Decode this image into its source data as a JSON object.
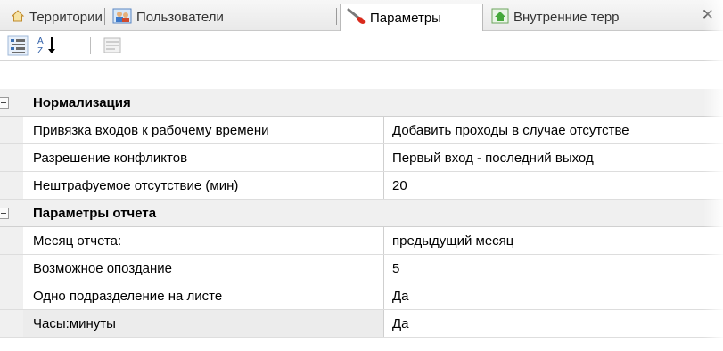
{
  "tabs": [
    {
      "label": "Территории",
      "icon": "home-icon"
    },
    {
      "label": "Пользователи",
      "icon": "users-icon"
    },
    {
      "label": "Параметры",
      "icon": "brush-icon",
      "active": true
    },
    {
      "label": "Внутренние терр",
      "icon": "home-green-icon"
    }
  ],
  "toolbar": {
    "categorized_icon": "categorized-view-icon",
    "sort_icon": "sort-az-icon",
    "sort_label": "AZ",
    "pages_icon": "property-pages-icon"
  },
  "categories": [
    {
      "title": "Нормализация",
      "rows": [
        {
          "name": "Привязка входов к рабочему времени",
          "value": "Добавить проходы в случае отсутстве"
        },
        {
          "name": "Разрешение конфликтов",
          "value": "Первый вход - последний выход"
        },
        {
          "name": "Нештрафуемое отсутствие (мин)",
          "value": "20"
        }
      ]
    },
    {
      "title": "Параметры отчета",
      "rows": [
        {
          "name": "Месяц отчета:",
          "value": "предыдущий месяц"
        },
        {
          "name": "Возможное опоздание",
          "value": "5"
        },
        {
          "name": "Одно подразделение на листе",
          "value": "Да"
        },
        {
          "name": "Часы:минуты",
          "value": "Да"
        }
      ]
    }
  ],
  "colors": {
    "category_bg": "#f0f0f0",
    "grid_line": "#dddddd"
  }
}
